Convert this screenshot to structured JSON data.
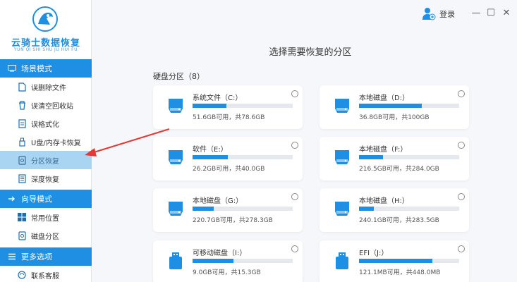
{
  "app": {
    "name": "云骑士数据恢复",
    "name_pinyin": "YUN QI SHI SHU JU HUI FU"
  },
  "topbar": {
    "login_label": "登录",
    "minimize": "—",
    "maximize": "☐",
    "close": "✕"
  },
  "sidebar": {
    "scene_mode": {
      "label": "场景模式",
      "items": [
        {
          "label": "误删除文件",
          "icon": "file-icon"
        },
        {
          "label": "误清空回收站",
          "icon": "recycle-bin-icon"
        },
        {
          "label": "误格式化",
          "icon": "format-icon"
        },
        {
          "label": "U盘/内存卡恢复",
          "icon": "usb-icon"
        },
        {
          "label": "分区恢复",
          "icon": "partition-icon",
          "active": true
        },
        {
          "label": "深度恢复",
          "icon": "deep-recovery-icon"
        }
      ]
    },
    "guide_mode": {
      "label": "向导模式",
      "items": [
        {
          "label": "常用位置",
          "icon": "windows-icon"
        },
        {
          "label": "磁盘分区",
          "icon": "disk-icon"
        }
      ]
    },
    "more_options": {
      "label": "更多选项",
      "items": [
        {
          "label": "联系客服",
          "icon": "support-icon"
        }
      ]
    }
  },
  "main": {
    "title": "选择需要恢复的分区",
    "group_label": "硬盘分区（8）",
    "partitions": [
      {
        "name": "系统文件（C:）",
        "free": "51.6GB可用，共78.6GB",
        "used_fraction": 0.34,
        "icon": "disk-icon"
      },
      {
        "name": "本地磁盘（D:）",
        "free": "36.8GB可用，共100GB",
        "used_fraction": 0.63,
        "icon": "disk-icon"
      },
      {
        "name": "软件（E:）",
        "free": "26.2GB可用，共40.0GB",
        "used_fraction": 0.35,
        "icon": "disk-icon"
      },
      {
        "name": "本地磁盘（F:）",
        "free": "216.5GB可用，共284.0GB",
        "used_fraction": 0.24,
        "icon": "disk-icon"
      },
      {
        "name": "本地磁盘（G:）",
        "free": "220.7GB可用，共278.3GB",
        "used_fraction": 0.21,
        "icon": "disk-icon"
      },
      {
        "name": "本地磁盘（H:）",
        "free": "240.1GB可用，共283.5GB",
        "used_fraction": 0.15,
        "icon": "disk-icon"
      },
      {
        "name": "可移动磁盘（I:）",
        "free": "9.0GB可用，共15.3GB",
        "used_fraction": 0.41,
        "icon": "usb-drive-icon"
      },
      {
        "name": "EFI（J:）",
        "free": "121.1MB可用，共448.0MB",
        "used_fraction": 0.73,
        "icon": "usb-drive-icon"
      }
    ]
  },
  "colors": {
    "accent": "#1e8fe2",
    "active_nav": "#a9d5f2",
    "arrow": "#e53935"
  }
}
